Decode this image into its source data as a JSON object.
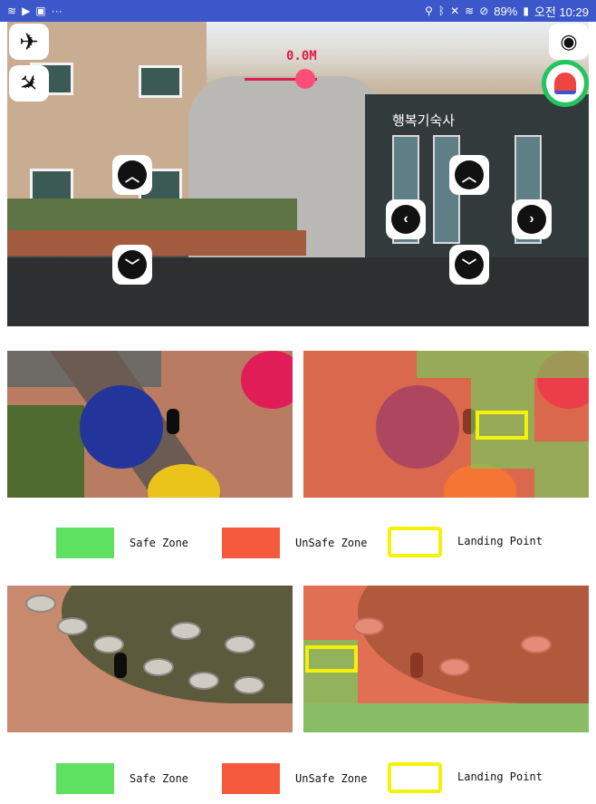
{
  "status_bar": {
    "battery": "89%",
    "clock": "오전 10:29",
    "left_icons": [
      "wifi-icon",
      "play-store-icon",
      "image-icon",
      "more-icon"
    ],
    "right_icons": [
      "location-icon",
      "bluetooth-icon",
      "mute-icon",
      "wifi-icon",
      "no-signal-icon",
      "battery-icon"
    ]
  },
  "camera": {
    "altitude_label": "0.0M",
    "building_sign": "행복기숙사",
    "altitude_slider_value": 0.7
  },
  "controls": {
    "takeoff": "takeoff-icon",
    "landing": "landing-icon",
    "camera": "camera-icon",
    "alarm": "siren-icon"
  },
  "legend": {
    "safe_label": "Safe Zone",
    "unsafe_label": "UnSafe Zone",
    "landing_label": "Landing Point"
  },
  "colors": {
    "safe": "#5ee060",
    "unsafe": "#f55a3c",
    "landing": "#f5f20a",
    "status_bar": "#3b57c9",
    "alarm_ring": "#22c55e"
  }
}
